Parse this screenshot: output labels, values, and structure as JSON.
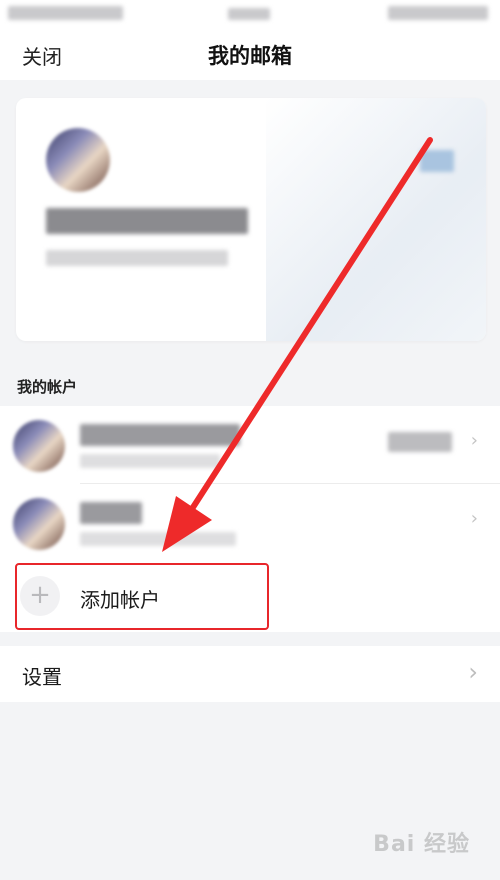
{
  "header": {
    "close_label": "关闭",
    "title": "我的邮箱"
  },
  "accounts_section": {
    "label": "我的帐户"
  },
  "add_account": {
    "label": "添加帐户",
    "icon": "plus-icon"
  },
  "settings": {
    "label": "设置",
    "icon": "chevron-right-icon"
  },
  "annotation": {
    "highlight_color": "#e8262b",
    "arrow_color": "#ee2a2a"
  },
  "watermark": {
    "text": "Bai 经验"
  }
}
